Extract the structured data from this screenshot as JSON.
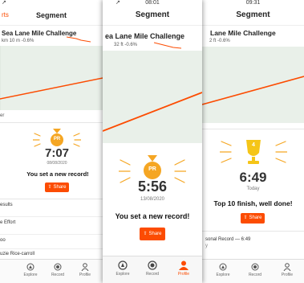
{
  "colors": {
    "accent": "#fc4c02",
    "chart_bg": "#e9f0e9",
    "gold": "#f5a623"
  },
  "screen1": {
    "status_time": "",
    "nav_back": "rts",
    "nav_title": "Segment",
    "segment_title": "Sea Lane Mile Challenge",
    "stats": "km  10 m  -0.6%",
    "side_label": "er",
    "medal_label": "PR",
    "time": "7:07",
    "date": "08/08/2020",
    "message": "You set a new record!",
    "share_label": "Share",
    "rows": [
      "esults",
      "e Effort",
      "oo",
      "uzie Rice-carroll"
    ],
    "tabs": [
      "Explore",
      "Record",
      "Profile"
    ]
  },
  "screen2": {
    "status_time": "08:01",
    "nav_title": "Segment",
    "segment_title": "ea Lane Mile Challenge",
    "stats": "32 ft   -0.6%",
    "medal_label": "PR",
    "time": "5:56",
    "date": "13/08/2020",
    "message": "You set a new record!",
    "share_label": "Share",
    "tabs": [
      "Explore",
      "Record",
      "Profile"
    ]
  },
  "screen3": {
    "status_time": "09:31",
    "nav_title": "Segment",
    "segment_title": "Lane Mile Challenge",
    "stats": "2 ft   -0.6%",
    "medal_label": "4",
    "time": "6:49",
    "date": "Today",
    "message": "Top 10 finish, well done!",
    "share_label": "Share",
    "row_personal": "sonal Record — 6:49",
    "row_sub": "y",
    "tabs": [
      "Explore",
      "Record",
      "Profile"
    ]
  }
}
